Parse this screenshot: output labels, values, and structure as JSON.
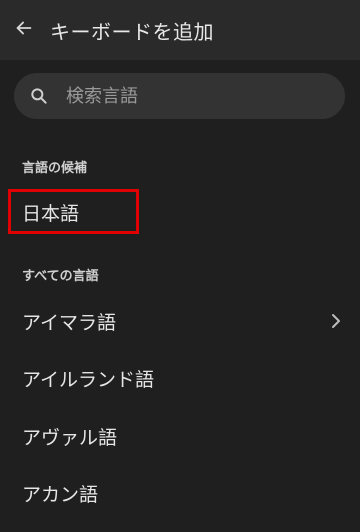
{
  "header": {
    "title": "キーボードを追加",
    "back_icon": "arrow-left-icon"
  },
  "search": {
    "placeholder": "検索言語",
    "value": "",
    "icon": "search-icon"
  },
  "suggested": {
    "label": "言語の候補",
    "items": [
      {
        "label": "日本語",
        "highlighted": true,
        "highlight_color": "#e00000"
      }
    ]
  },
  "all_languages": {
    "label": "すべての言語",
    "items": [
      {
        "label": "アイマラ語",
        "has_chevron": true
      },
      {
        "label": "アイルランド語",
        "has_chevron": false
      },
      {
        "label": "アヴァル語",
        "has_chevron": false
      },
      {
        "label": "アカン語",
        "has_chevron": false
      }
    ]
  },
  "colors": {
    "background": "#1f1f1f",
    "header_bg": "#2a2a2a",
    "search_bg": "#333333",
    "text": "#e6e6e6",
    "highlight": "#e00000"
  }
}
